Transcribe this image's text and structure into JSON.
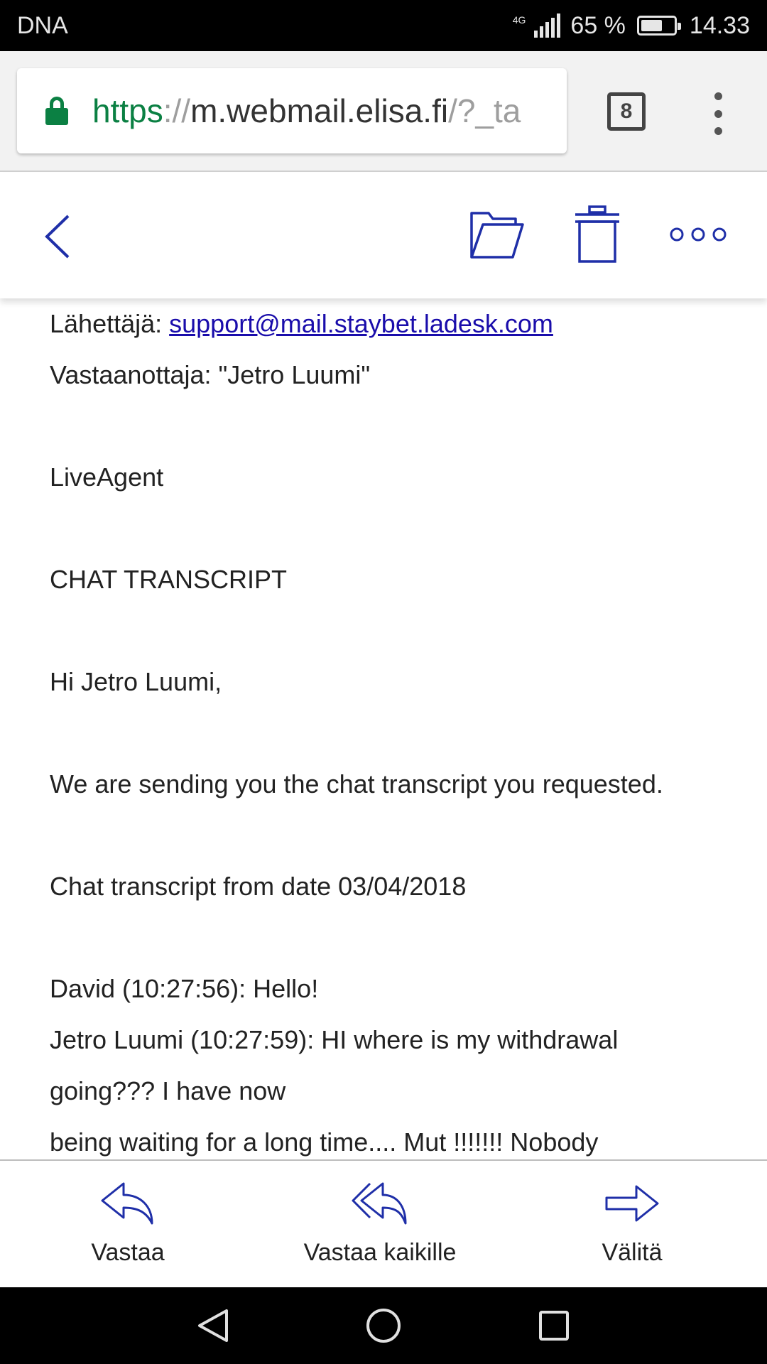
{
  "status_bar": {
    "carrier": "DNA",
    "network_type": "4G",
    "battery": "65 %",
    "battery_level": 0.65,
    "time": "14.33"
  },
  "browser": {
    "url_scheme": "https",
    "url_separator": "://",
    "url_host": "m.webmail.elisa.fi",
    "url_rest": "/?_ta",
    "tab_count": "8",
    "lock_icon": "lock-icon",
    "menu_icon": "more-vert-icon"
  },
  "toolbar": {
    "back_icon": "chevron-left-icon",
    "folder_icon": "folder-icon",
    "delete_icon": "trash-icon",
    "more_icon": "more-horiz-icon",
    "accent_color": "#1f2fa8"
  },
  "email": {
    "sender_label": "Lähettäjä: ",
    "sender_email": "support@mail.staybet.ladesk.com",
    "recipient_line": "Vastaanottaja: \"Jetro Luumi\"",
    "brand": "LiveAgent",
    "heading": "CHAT TRANSCRIPT",
    "greeting": "Hi Jetro Luumi,",
    "intro": "We are sending you the chat transcript you requested.",
    "date_line": "Chat transcript from date 03/04/2018",
    "transcript": [
      "David (10:27:56): Hello!",
      "Jetro Luumi (10:27:59): HI where is my withdrawal",
      "going??? I have now",
      "being waiting for a long time.... Mut !!!!!!! Nobody"
    ]
  },
  "actions": {
    "reply": "Vastaa",
    "reply_all": "Vastaa kaikille",
    "forward": "Välitä"
  },
  "nav": {
    "back": "nav-back-icon",
    "home": "nav-home-icon",
    "recents": "nav-recents-icon"
  }
}
